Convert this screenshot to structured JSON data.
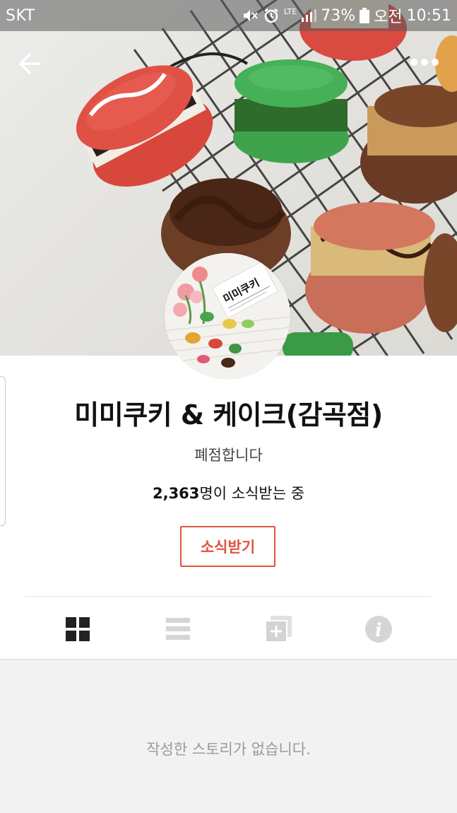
{
  "status_bar": {
    "carrier": "SKT",
    "battery_percent": "73%",
    "ampm": "오전",
    "time": "10:51",
    "network": "LTE",
    "icons": [
      "mute-icon",
      "alarm-icon",
      "lte-icon",
      "signal-icon",
      "battery-icon"
    ]
  },
  "header": {
    "back_icon": "arrow-left-icon",
    "more_icon": "more-dots-icon"
  },
  "profile": {
    "name": "미미쿠키 & 케이크(감곡점)",
    "description": "폐점합니다",
    "followers_count": "2,363",
    "followers_suffix": "명이 소식받는 중",
    "avatar_text": "미미쿠키"
  },
  "actions": {
    "subscribe_label": "소식받기",
    "accent_color": "#e0533f"
  },
  "tabs": [
    {
      "icon": "grid-view-icon",
      "active": true
    },
    {
      "icon": "list-view-icon",
      "active": false
    },
    {
      "icon": "add-collection-icon",
      "active": false
    },
    {
      "icon": "info-icon",
      "active": false
    }
  ],
  "feed": {
    "empty_message": "작성한 스토리가 없습니다."
  }
}
